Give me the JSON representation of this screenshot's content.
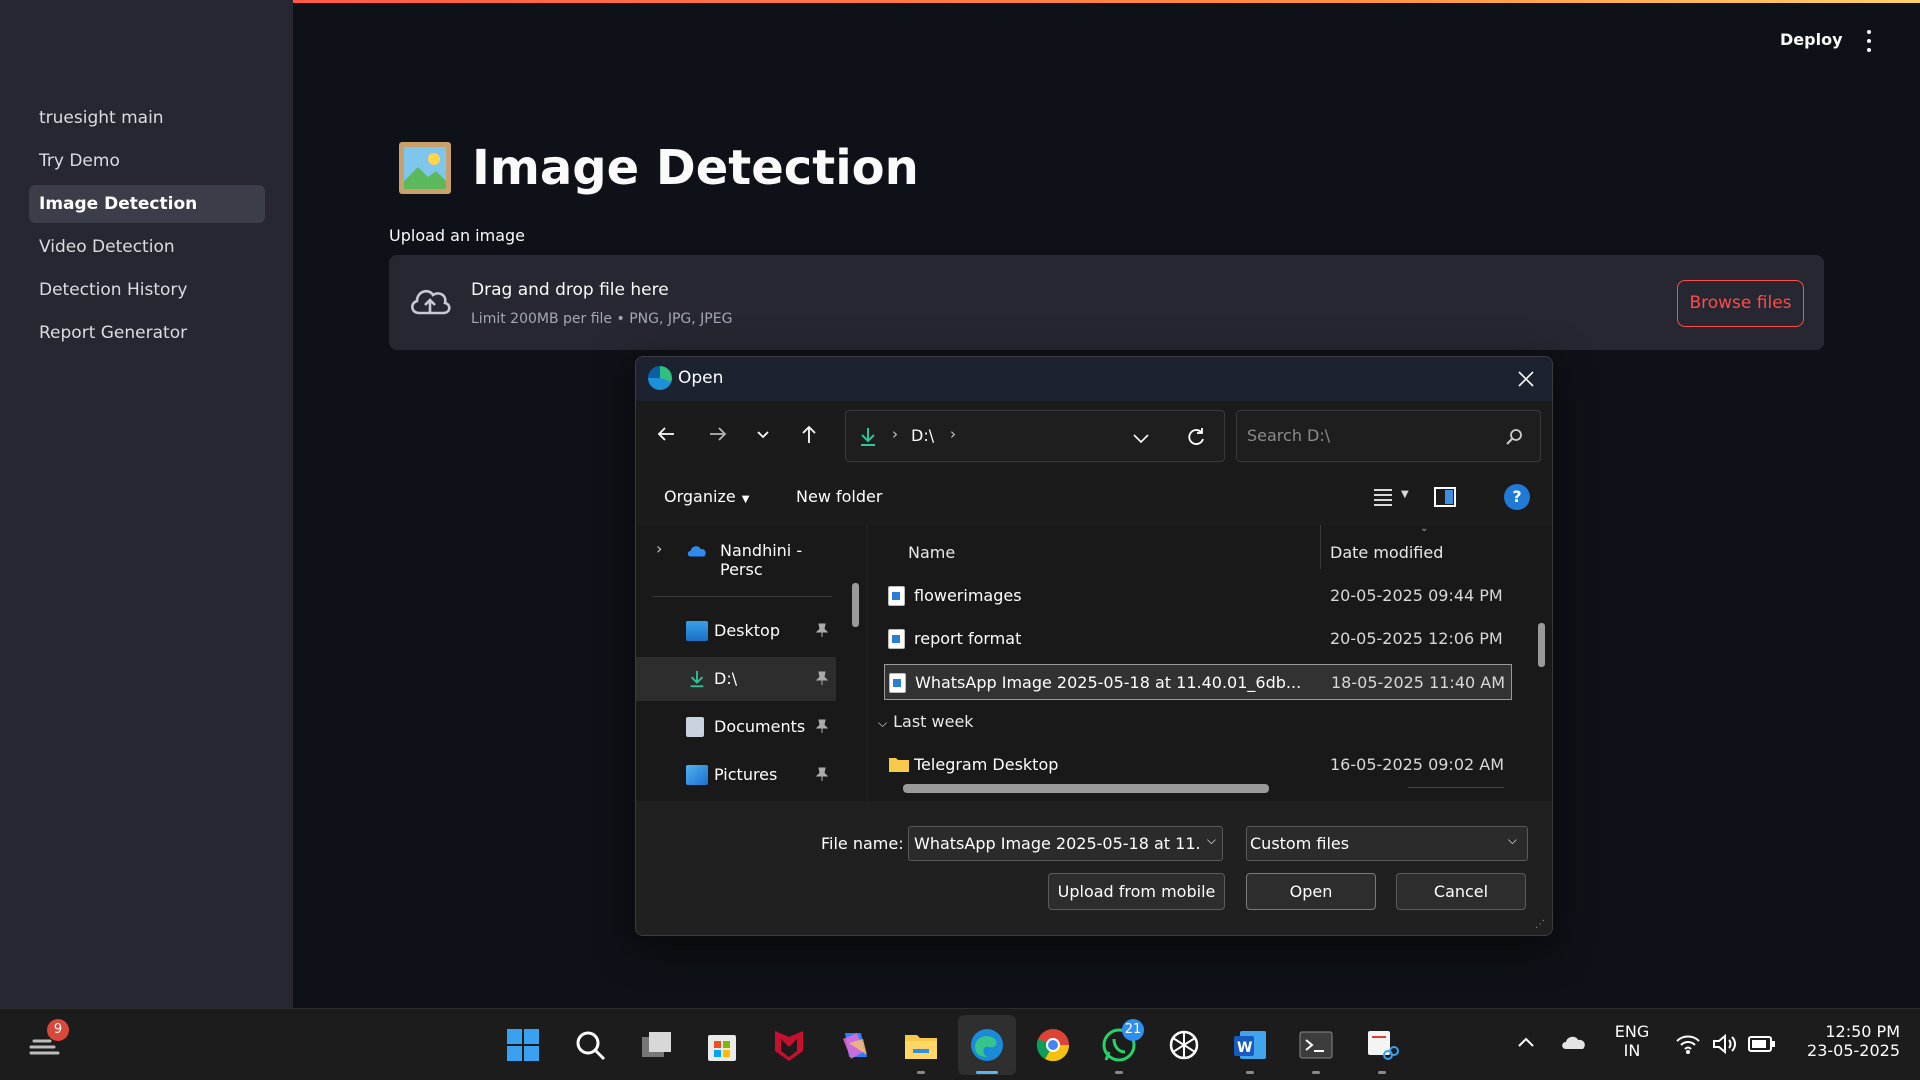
{
  "sidebar": {
    "items": [
      {
        "label": "truesight main"
      },
      {
        "label": "Try Demo"
      },
      {
        "label": "Image Detection"
      },
      {
        "label": "Video Detection"
      },
      {
        "label": "Detection History"
      },
      {
        "label": "Report Generator"
      }
    ],
    "active_index": 2
  },
  "header": {
    "deploy_label": "Deploy"
  },
  "main": {
    "title": "Image Detection",
    "upload_label": "Upload an image",
    "dropzone": {
      "title": "Drag and drop file here",
      "limit": "Limit 200MB per file • PNG, JPG, JPEG",
      "browse_label": "Browse files"
    }
  },
  "dialog": {
    "title": "Open",
    "address": "D:\\",
    "search_placeholder": "Search D:\\",
    "organize_label": "Organize",
    "new_folder_label": "New folder",
    "nav_pane": [
      {
        "label": "Nandhini - Persc",
        "icon": "onedrive-cloud-icon"
      },
      {
        "label": "Desktop",
        "icon": "desktop-icon"
      },
      {
        "label": "D:\\",
        "icon": "download-drive-icon"
      },
      {
        "label": "Documents",
        "icon": "documents-icon"
      },
      {
        "label": "Pictures",
        "icon": "pictures-icon"
      }
    ],
    "columns": {
      "name": "Name",
      "date": "Date modified"
    },
    "files": [
      {
        "name": "flowerimages",
        "date": "20-05-2025 09:44 PM"
      },
      {
        "name": "report format",
        "date": "20-05-2025 12:06 PM"
      },
      {
        "name": "WhatsApp Image 2025-05-18 at 11.40.01_6db...",
        "date": "18-05-2025 11:40 AM"
      }
    ],
    "group_last_week": "Last week",
    "last_week_files": [
      {
        "name": "Telegram Desktop",
        "date": "16-05-2025 09:02 AM"
      }
    ],
    "file_name_label": "File name:",
    "file_name_value": "WhatsApp Image 2025-05-18 at 11.",
    "file_type": "Custom files",
    "upload_mobile_label": "Upload from mobile",
    "open_label": "Open",
    "cancel_label": "Cancel"
  },
  "taskbar": {
    "weather_badge": "9",
    "whatsapp_badge": "21",
    "lang_line1": "ENG",
    "lang_line2": "IN",
    "time": "12:50 PM",
    "date": "23-05-2025"
  }
}
